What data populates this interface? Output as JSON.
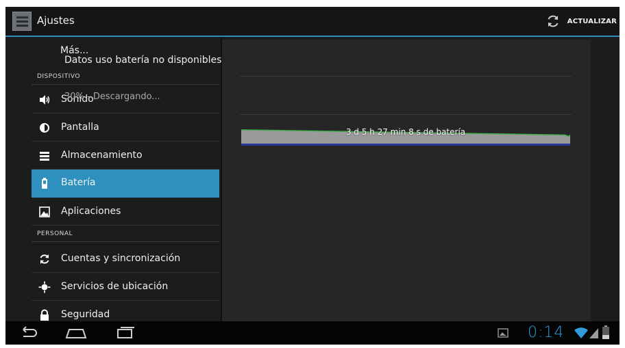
{
  "action_bar": {
    "title": "Ajustes",
    "refresh_label": "ACTUALIZAR"
  },
  "sidebar": {
    "more_label": "Más...",
    "section_device": "DISPOSITIVO",
    "section_personal": "PERSONAL",
    "items": [
      {
        "label": "Sonido",
        "icon": "speaker-icon"
      },
      {
        "label": "Pantalla",
        "icon": "brightness-icon"
      },
      {
        "label": "Almacenamiento",
        "icon": "storage-icon"
      },
      {
        "label": "Batería",
        "icon": "battery-icon",
        "selected": true
      },
      {
        "label": "Aplicaciones",
        "icon": "apps-icon"
      },
      {
        "label": "Cuentas y sincronización",
        "icon": "sync-icon"
      },
      {
        "label": "Servicios de ubicación",
        "icon": "location-icon"
      },
      {
        "label": "Seguridad",
        "icon": "lock-icon"
      }
    ]
  },
  "detail": {
    "usage_title": "Datos uso batería no disponibles",
    "status": "30% - Descargando...",
    "graph_label": "3 d 5 h 27 min 8 s de batería",
    "graph_level_start": 0.48,
    "graph_level_end": 0.3
  },
  "status_bar": {
    "clock": "0:14"
  },
  "colors": {
    "accent": "#2d90bf",
    "background": "#1c1c1c",
    "detail_background": "#262626",
    "battery_fill": "#9a9a9a",
    "battery_line": "#3fae49",
    "baseline": "#2a3a9a",
    "clock": "#2f9bd8"
  }
}
